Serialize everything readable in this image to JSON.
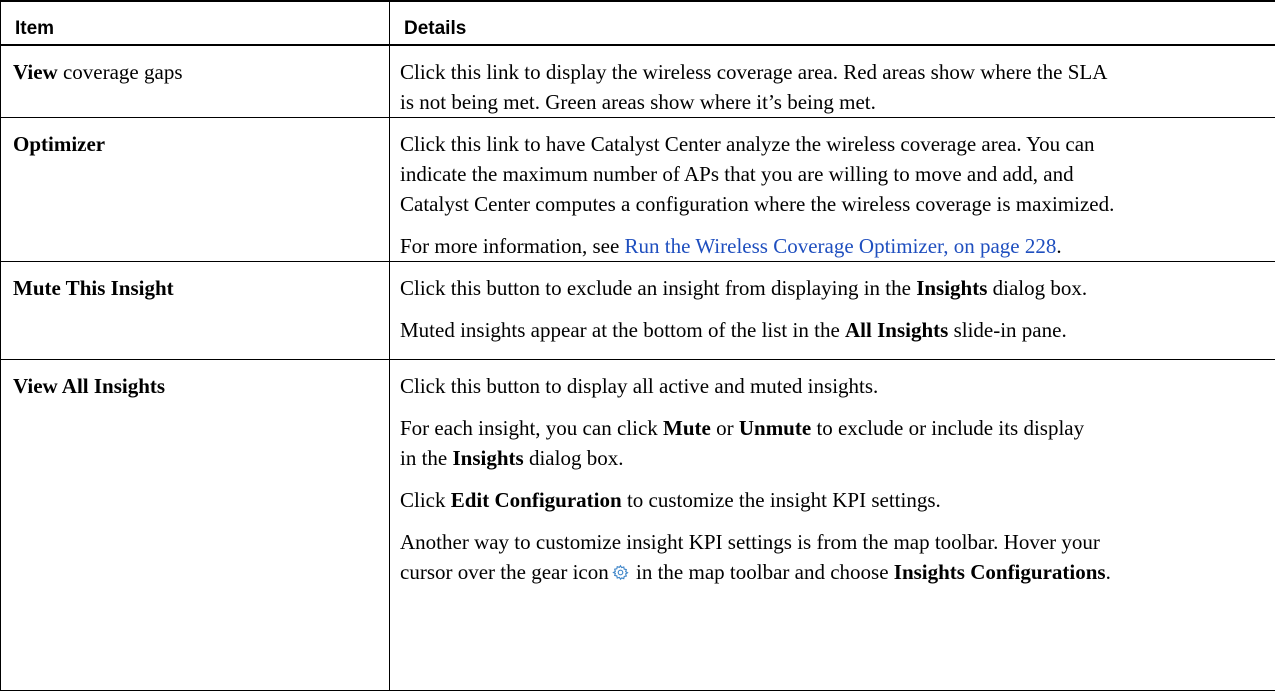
{
  "table": {
    "headers": {
      "item": "Item",
      "details": "Details"
    },
    "rows": [
      {
        "item_bold": "View",
        "item_rest": " coverage gaps",
        "details": {
          "line1": "Click this link to display the wireless coverage area. Red areas show where the SLA",
          "line2": "is not being met. Green areas show where it’s being met."
        }
      },
      {
        "item_bold": "Optimizer",
        "details": {
          "line1": "Click this link to have Catalyst Center analyze the wireless coverage area. You can",
          "line2": "indicate the maximum number of APs that you are willing to move and add, and",
          "line3": "Catalyst Center computes a configuration where the wireless coverage is maximized.",
          "p2_pre": "For more information, see ",
          "p2_link": "Run the Wireless Coverage Optimizer, on page 228",
          "p2_post": "."
        }
      },
      {
        "item_bold": "Mute This Insight",
        "details": {
          "p1_pre": "Click this button to exclude an insight from displaying in the ",
          "p1_b": "Insights",
          "p1_post": " dialog box.",
          "p2_pre": "Muted insights appear at the bottom of the list in the ",
          "p2_b": "All Insights",
          "p2_post": " slide-in pane."
        }
      },
      {
        "item_bold": "View All Insights",
        "details": {
          "p1": "Click this button to display all active and muted insights.",
          "p2_pre": "For each insight, you can click ",
          "p2_b1": "Mute",
          "p2_mid": " or ",
          "p2_b2": "Unmute",
          "p2_post": " to exclude or include its display",
          "p2_l2_pre": "in the ",
          "p2_l2_b": "Insights",
          "p2_l2_post": " dialog box.",
          "p3_pre": "Click ",
          "p3_b": "Edit Configuration",
          "p3_post": " to customize the insight KPI settings.",
          "p4_line1": "Another way to customize insight KPI settings is from the map toolbar. Hover your",
          "p4_l2_pre": "cursor over the gear icon",
          "p4_l2_mid": " in the map toolbar and choose ",
          "p4_l2_b": "Insights Configurations",
          "p4_l2_post": "."
        }
      }
    ]
  },
  "icons": {
    "gear": "gear-icon"
  },
  "colors": {
    "link": "#1f4fbf",
    "gear": "#3f86c9"
  }
}
